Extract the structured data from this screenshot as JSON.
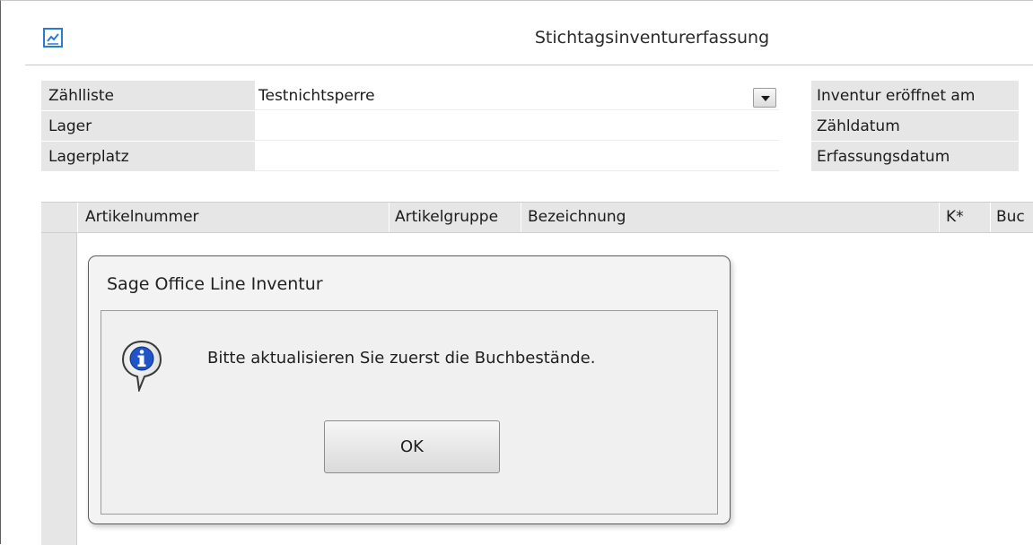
{
  "window": {
    "title": "Stichtagsinventurerfassung",
    "icon": "chart-icon"
  },
  "form": {
    "left": [
      {
        "label": "Zählliste",
        "value": "Testnichtsperre",
        "has_dropdown": true
      },
      {
        "label": "Lager",
        "value": ""
      },
      {
        "label": "Lagerplatz",
        "value": ""
      }
    ],
    "right": [
      {
        "label": "Inventur eröffnet am",
        "value": ""
      },
      {
        "label": "Zähldatum",
        "value": ""
      },
      {
        "label": "Erfassungsdatum",
        "value": ""
      }
    ]
  },
  "grid": {
    "columns": [
      "Artikelnummer",
      "Artikelgruppe",
      "Bezeichnung",
      "K*",
      "Buc"
    ],
    "rows": []
  },
  "dialog": {
    "title": "Sage Office Line Inventur",
    "message": "Bitte aktualisieren Sie zuerst die Buchbestände.",
    "icon": "info-icon",
    "ok_label": "OK"
  },
  "colors": {
    "label_background": "#e6e6e6",
    "dialog_background": "#f3f3f3",
    "info_icon_blue": "#1f55c8"
  }
}
